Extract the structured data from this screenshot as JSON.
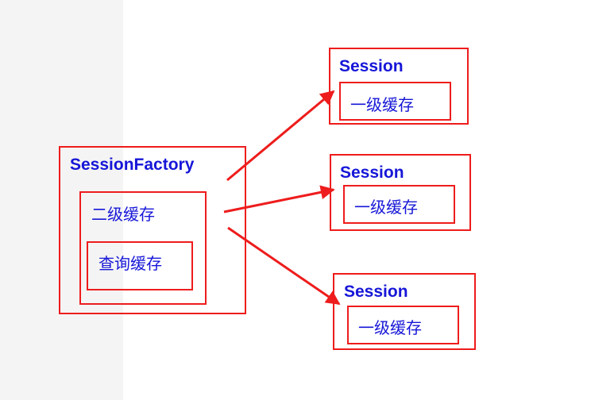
{
  "session_factory": {
    "title": "SessionFactory",
    "second_level_cache": "二级缓存",
    "query_cache": "查询缓存"
  },
  "sessions": [
    {
      "title": "Session",
      "first_level_cache": "一级缓存"
    },
    {
      "title": "Session",
      "first_level_cache": "一级缓存"
    },
    {
      "title": "Session",
      "first_level_cache": "一级缓存"
    }
  ],
  "colors": {
    "border": "#ee1c1c",
    "text": "#1616d8",
    "arrow": "#ee1c1c",
    "left_strip": "#f4f4f4"
  }
}
